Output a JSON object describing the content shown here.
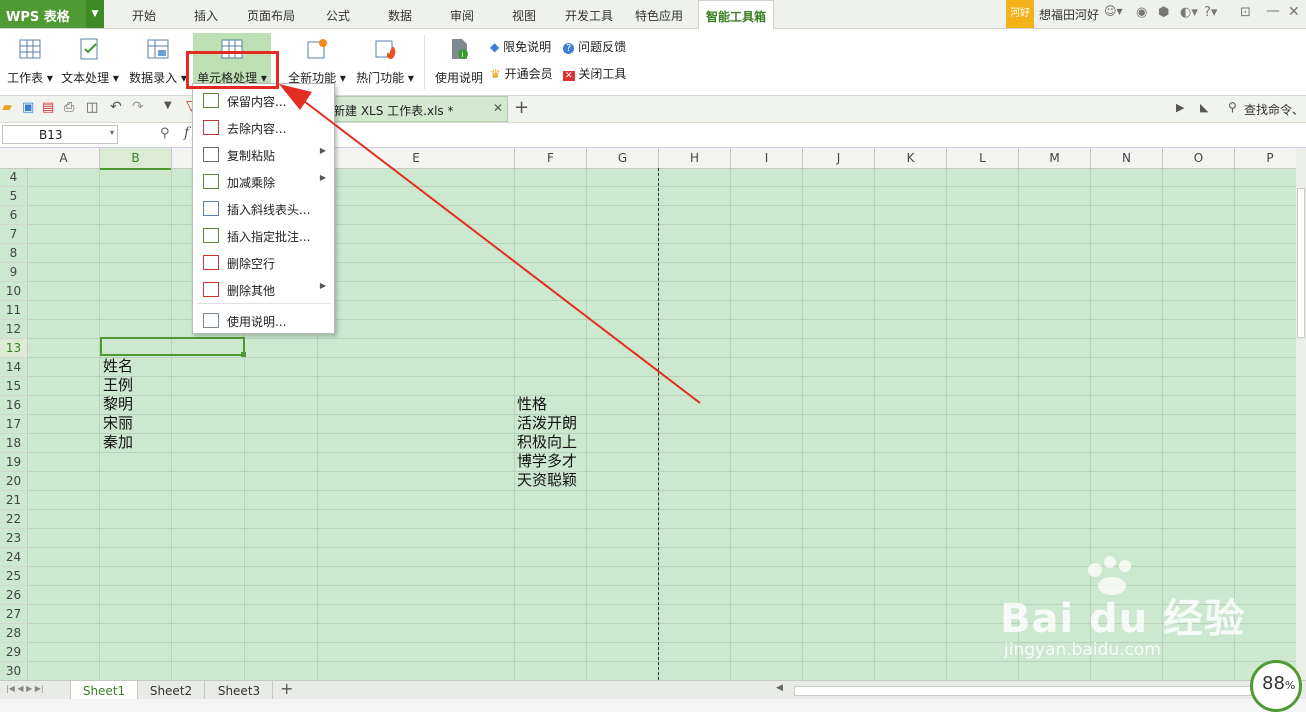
{
  "app": {
    "title": "WPS 表格",
    "menu_tabs": [
      "开始",
      "插入",
      "页面布局",
      "公式",
      "数据",
      "审阅",
      "视图",
      "开发工具",
      "特色应用",
      "智能工具箱"
    ],
    "active_tab": "智能工具箱",
    "user_badge": "河好",
    "user_name": "想福田河好"
  },
  "ribbon": {
    "buttons": [
      "工作表",
      "文本处理",
      "数据录入",
      "单元格处理",
      "全新功能",
      "热门功能",
      "使用说明"
    ],
    "links": [
      "限免说明",
      "问题反馈",
      "开通会员",
      "关闭工具"
    ]
  },
  "document_tab": {
    "name": "新建 XLS 工作表.xls *",
    "search_label": "查找命令、"
  },
  "formula_bar": {
    "name_box": "B13",
    "fx": "f"
  },
  "columns": [
    "A",
    "B",
    "",
    "",
    "E",
    "F",
    "G",
    "H",
    "I",
    "J",
    "K",
    "L",
    "M",
    "N",
    "O",
    "P"
  ],
  "rows": [
    "4",
    "5",
    "6",
    "7",
    "8",
    "9",
    "10",
    "11",
    "12",
    "13",
    "14",
    "15",
    "16",
    "17",
    "18",
    "19",
    "20",
    "21",
    "22",
    "23",
    "24",
    "25",
    "26",
    "27",
    "28",
    "29",
    "30"
  ],
  "cells": {
    "b14": "姓名",
    "b15": "王例",
    "b16": "黎明",
    "b17": "宋丽",
    "b18": "秦加",
    "f16": "性格",
    "f17": "活泼开朗",
    "f18": "积极向上",
    "f19": "博学多才",
    "f20": "天资聪颖"
  },
  "dropdown": {
    "items": [
      {
        "label": "保留内容...",
        "submenu": false
      },
      {
        "label": "去除内容...",
        "submenu": false
      },
      {
        "label": "复制粘贴",
        "submenu": true
      },
      {
        "label": "加减乘除",
        "submenu": true
      },
      {
        "label": "插入斜线表头...",
        "submenu": false
      },
      {
        "label": "插入指定批注...",
        "submenu": false
      },
      {
        "label": "删除空行",
        "submenu": false
      },
      {
        "label": "删除其他",
        "submenu": true
      },
      {
        "label": "使用说明...",
        "submenu": false
      }
    ]
  },
  "sheets": [
    "Sheet1",
    "Sheet2",
    "Sheet3"
  ],
  "active_sheet": "Sheet1",
  "zoom_label": "88",
  "zoom_unit": "%",
  "watermark": {
    "brand": "Bai du 经验",
    "url": "jingyan.baidu.com"
  },
  "colors": {
    "accent": "#4f9a32",
    "grid_bg": "#cce8cf",
    "highlight": "#e52c22"
  }
}
